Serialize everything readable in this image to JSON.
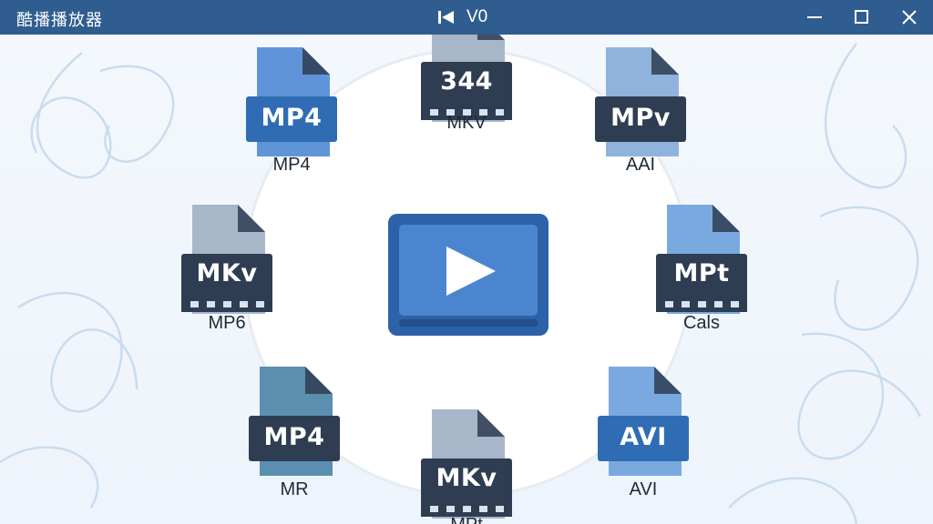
{
  "window": {
    "title": "酷播播放器",
    "center_label": "V0",
    "controls": [
      "minimize-icon",
      "maximize-icon",
      "close-icon"
    ]
  },
  "colors": {
    "titlebar": "#2f5d8f",
    "play_tile": "#2d62a8",
    "play_screen": "#4b85cf",
    "badge_dark": "#2f3d52",
    "badge_blue": "#2f6cb3",
    "page_light": "#7aa9e0",
    "page_gray": "#a7b6c8",
    "page_teal": "#5a8fb0"
  },
  "center_icon": "play-button-icon",
  "files": [
    {
      "id": "top",
      "badge": "344",
      "caption": "MKV"
    },
    {
      "id": "top-left",
      "badge": "MP4",
      "caption": "MP4"
    },
    {
      "id": "top-right",
      "badge": "MPv",
      "caption": "AAI"
    },
    {
      "id": "mid-left",
      "badge": "MKv",
      "caption": "MP6"
    },
    {
      "id": "mid-right",
      "badge": "MPt",
      "caption": "Cals"
    },
    {
      "id": "bottom-left",
      "badge": "MP4",
      "caption": "MR"
    },
    {
      "id": "bottom-right",
      "badge": "AVI",
      "caption": "AVI"
    },
    {
      "id": "bottom",
      "badge": "MKv",
      "caption": "MPt"
    }
  ]
}
